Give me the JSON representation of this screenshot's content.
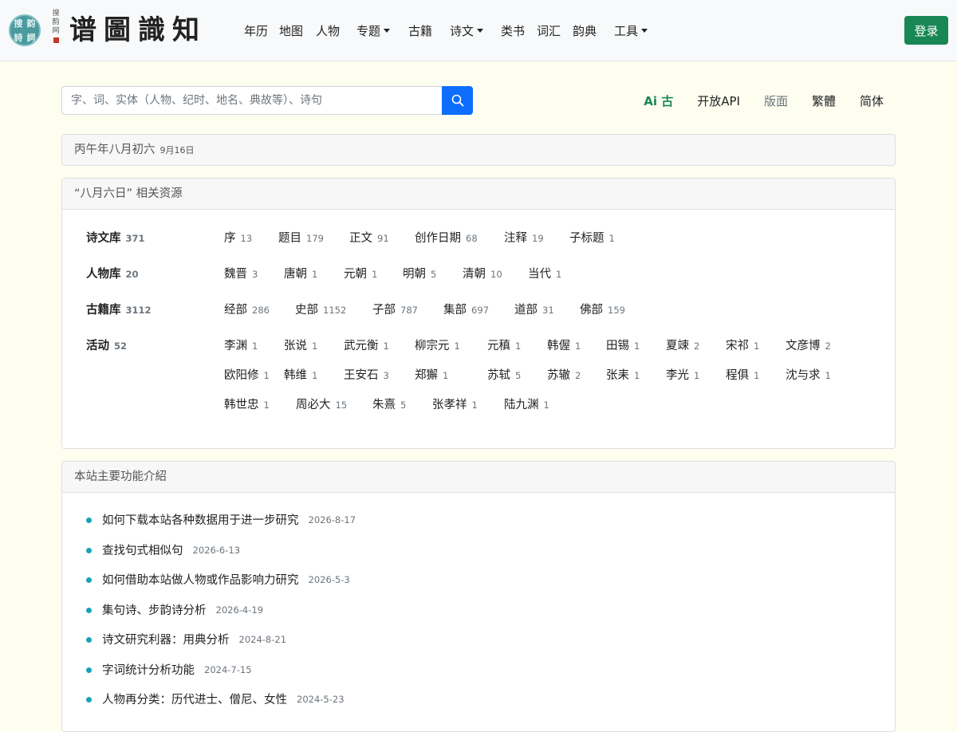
{
  "logo": {
    "seal_chars": [
      "搜",
      "韵",
      "詩",
      "詞"
    ],
    "vertical_text": "搜韵网",
    "title": "谱圖識知"
  },
  "nav": {
    "items": [
      {
        "label": "年历",
        "dropdown": false
      },
      {
        "label": "地图",
        "dropdown": false
      },
      {
        "label": "人物",
        "dropdown": false
      },
      {
        "label": "专题",
        "dropdown": true
      },
      {
        "label": "古籍",
        "dropdown": false
      },
      {
        "label": "诗文",
        "dropdown": true
      },
      {
        "label": "类书",
        "dropdown": false
      },
      {
        "label": "词汇",
        "dropdown": false
      },
      {
        "label": "韵典",
        "dropdown": false
      },
      {
        "label": "工具",
        "dropdown": true
      }
    ],
    "login": "登录"
  },
  "search": {
    "placeholder": "字、词、实体（人物、纪时、地名、典故等）、诗句"
  },
  "right_links": {
    "ai": "Ai 古",
    "api": "开放API",
    "layout": "版面",
    "traditional": "繁體",
    "simplified": "简体"
  },
  "date_card": {
    "lunar": "丙午年八月初六",
    "solar": "9月16日"
  },
  "resources": {
    "title": "“八月六日” 相关资源",
    "groups": [
      {
        "name": "诗文库",
        "count": "371",
        "items": [
          {
            "name": "序",
            "count": "13"
          },
          {
            "name": "题目",
            "count": "179"
          },
          {
            "name": "正文",
            "count": "91"
          },
          {
            "name": "创作日期",
            "count": "68"
          },
          {
            "name": "注释",
            "count": "19"
          },
          {
            "name": "子标题",
            "count": "1"
          }
        ]
      },
      {
        "name": "人物库",
        "count": "20",
        "items": [
          {
            "name": "魏晋",
            "count": "3"
          },
          {
            "name": "唐朝",
            "count": "1"
          },
          {
            "name": "元朝",
            "count": "1"
          },
          {
            "name": "明朝",
            "count": "5"
          },
          {
            "name": "清朝",
            "count": "10"
          },
          {
            "name": "当代",
            "count": "1"
          }
        ]
      },
      {
        "name": "古籍库",
        "count": "3112",
        "items": [
          {
            "name": "经部",
            "count": "286"
          },
          {
            "name": "史部",
            "count": "1152"
          },
          {
            "name": "子部",
            "count": "787"
          },
          {
            "name": "集部",
            "count": "697"
          },
          {
            "name": "道部",
            "count": "31"
          },
          {
            "name": "佛部",
            "count": "159"
          }
        ]
      },
      {
        "name": "活动",
        "count": "52",
        "items": [
          {
            "name": "李渊",
            "count": "1"
          },
          {
            "name": "张说",
            "count": "1"
          },
          {
            "name": "武元衡",
            "count": "1"
          },
          {
            "name": "柳宗元",
            "count": "1"
          },
          {
            "name": "元稹",
            "count": "1"
          },
          {
            "name": "韩偓",
            "count": "1"
          },
          {
            "name": "田锡",
            "count": "1"
          },
          {
            "name": "夏竦",
            "count": "2"
          },
          {
            "name": "宋祁",
            "count": "1"
          },
          {
            "name": "文彦博",
            "count": "2"
          },
          {
            "name": "欧阳修",
            "count": "1"
          },
          {
            "name": "韩维",
            "count": "1"
          },
          {
            "name": "王安石",
            "count": "3"
          },
          {
            "name": "郑獬",
            "count": "1"
          },
          {
            "name": "苏轼",
            "count": "5"
          },
          {
            "name": "苏辙",
            "count": "2"
          },
          {
            "name": "张耒",
            "count": "1"
          },
          {
            "name": "李光",
            "count": "1"
          },
          {
            "name": "程俱",
            "count": "1"
          },
          {
            "name": "沈与求",
            "count": "1"
          },
          {
            "name": "韩世忠",
            "count": "1"
          },
          {
            "name": "周必大",
            "count": "15"
          },
          {
            "name": "朱熹",
            "count": "5"
          },
          {
            "name": "张孝祥",
            "count": "1"
          },
          {
            "name": "陆九渊",
            "count": "1"
          }
        ]
      }
    ]
  },
  "features": {
    "title": "本站主要功能介紹",
    "items": [
      {
        "title": "如何下载本站各种数据用于进一步研究",
        "date": "2026-8-17"
      },
      {
        "title": "查找句式相似句",
        "date": "2026-6-13"
      },
      {
        "title": "如何借助本站做人物或作品影响力研究",
        "date": "2026-5-3"
      },
      {
        "title": "集句诗、步韵诗分析",
        "date": "2026-4-19"
      },
      {
        "title": "诗文研究利器：用典分析",
        "date": "2024-8-21"
      },
      {
        "title": "字词统计分析功能",
        "date": "2024-7-15"
      },
      {
        "title": "人物再分类：历代进士、僧尼、女性",
        "date": "2024-5-23"
      }
    ]
  },
  "colors": {
    "page_bg": "#fdfdf0",
    "login_green": "#198754",
    "search_blue": "#0d6efd",
    "bullet_cyan": "#17a2b8"
  }
}
